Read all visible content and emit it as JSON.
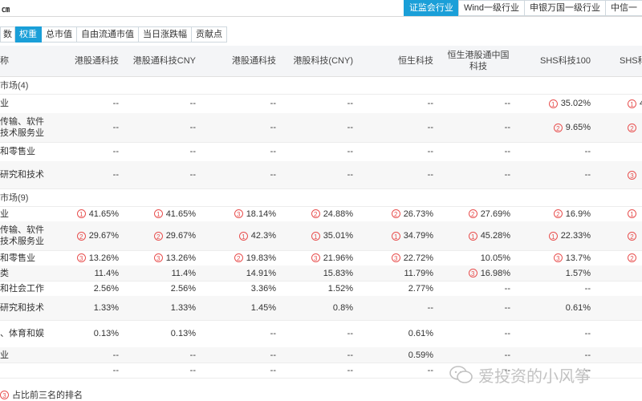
{
  "top_left": "㎝",
  "industry_tabs": [
    "证监会行业",
    "Wind一级行业",
    "申银万国一级行业",
    "中信一"
  ],
  "sub_tabs": [
    "数",
    "权重",
    "总市值",
    "自由流通市值",
    "当日涨跌幅",
    "贡献点"
  ],
  "columns": {
    "name": "称",
    "c1": "港股通科技",
    "c2": "港股通科技CNY",
    "c3": "港股通科技",
    "c4": "港股科技(CNY)",
    "c5": "恒生科技",
    "c6": "恒生港股通中国科技",
    "c7": "SHS科技100",
    "c8": "SHS科"
  },
  "sections": [
    {
      "label": "市场(4)",
      "rows": [
        {
          "name": "业",
          "cells": [
            [
              "",
              "--"
            ],
            [
              "",
              "--"
            ],
            [
              "",
              "--"
            ],
            [
              "",
              "--"
            ],
            [
              "",
              "--"
            ],
            [
              "",
              "--"
            ],
            [
              "1",
              "35.02%"
            ],
            [
              "1",
              "4"
            ]
          ]
        },
        {
          "name": "传输、软件技术服务业",
          "cells": [
            [
              "",
              "--"
            ],
            [
              "",
              "--"
            ],
            [
              "",
              "--"
            ],
            [
              "",
              "--"
            ],
            [
              "",
              "--"
            ],
            [
              "",
              "--"
            ],
            [
              "2",
              "9.65%"
            ],
            [
              "2",
              ""
            ]
          ]
        },
        {
          "name": "和零售业",
          "cells": [
            [
              "",
              "--"
            ],
            [
              "",
              "--"
            ],
            [
              "",
              "--"
            ],
            [
              "",
              "--"
            ],
            [
              "",
              "--"
            ],
            [
              "",
              "--"
            ],
            [
              "",
              "--"
            ],
            [
              "",
              ""
            ]
          ]
        },
        {
          "name": "研究和技术",
          "cells": [
            [
              "",
              "--"
            ],
            [
              "",
              "--"
            ],
            [
              "",
              "--"
            ],
            [
              "",
              "--"
            ],
            [
              "",
              "--"
            ],
            [
              "",
              "--"
            ],
            [
              "",
              "--"
            ],
            [
              "3",
              ""
            ]
          ]
        }
      ]
    },
    {
      "label": "市场(9)",
      "rows": [
        {
          "name": "业",
          "cells": [
            [
              "1",
              "41.65%"
            ],
            [
              "1",
              "41.65%"
            ],
            [
              "3",
              "18.14%"
            ],
            [
              "2",
              "24.88%"
            ],
            [
              "2",
              "26.73%"
            ],
            [
              "2",
              "27.69%"
            ],
            [
              "2",
              "16.9%"
            ],
            [
              "1",
              ""
            ]
          ]
        },
        {
          "name": "传输、软件技术服务业",
          "cells": [
            [
              "2",
              "29.67%"
            ],
            [
              "2",
              "29.67%"
            ],
            [
              "1",
              "42.3%"
            ],
            [
              "1",
              "35.01%"
            ],
            [
              "1",
              "34.79%"
            ],
            [
              "1",
              "45.28%"
            ],
            [
              "1",
              "22.33%"
            ],
            [
              "2",
              ""
            ]
          ]
        },
        {
          "name": "和零售业",
          "cells": [
            [
              "3",
              "13.26%"
            ],
            [
              "3",
              "13.26%"
            ],
            [
              "2",
              "19.83%"
            ],
            [
              "3",
              "21.96%"
            ],
            [
              "3",
              "22.72%"
            ],
            [
              "",
              "10.05%"
            ],
            [
              "3",
              "13.7%"
            ],
            [
              "2",
              ""
            ]
          ]
        },
        {
          "name": "类",
          "cells": [
            [
              "",
              "11.4%"
            ],
            [
              "",
              "11.4%"
            ],
            [
              "",
              "14.91%"
            ],
            [
              "",
              "15.83%"
            ],
            [
              "",
              "11.79%"
            ],
            [
              "3",
              "16.98%"
            ],
            [
              "",
              "1.57%"
            ],
            [
              "",
              ""
            ]
          ]
        },
        {
          "name": "和社会工作",
          "cells": [
            [
              "",
              "2.56%"
            ],
            [
              "",
              "2.56%"
            ],
            [
              "",
              "3.36%"
            ],
            [
              "",
              "1.52%"
            ],
            [
              "",
              "2.77%"
            ],
            [
              "",
              "--"
            ],
            [
              "",
              "--"
            ],
            [
              "",
              ""
            ]
          ]
        },
        {
          "name": "研究和技术",
          "cells": [
            [
              "",
              "1.33%"
            ],
            [
              "",
              "1.33%"
            ],
            [
              "",
              "1.45%"
            ],
            [
              "",
              "0.8%"
            ],
            [
              "",
              "--"
            ],
            [
              "",
              "--"
            ],
            [
              "",
              "0.61%"
            ],
            [
              "",
              ""
            ]
          ]
        },
        {
          "name": "、体育和娱",
          "cells": [
            [
              "",
              "0.13%"
            ],
            [
              "",
              "0.13%"
            ],
            [
              "",
              "--"
            ],
            [
              "",
              "--"
            ],
            [
              "",
              "0.61%"
            ],
            [
              "",
              "--"
            ],
            [
              "",
              "--"
            ],
            [
              "",
              ""
            ]
          ]
        },
        {
          "name": "业",
          "cells": [
            [
              "",
              "--"
            ],
            [
              "",
              "--"
            ],
            [
              "",
              "--"
            ],
            [
              "",
              "--"
            ],
            [
              "",
              "0.59%"
            ],
            [
              "",
              "--"
            ],
            [
              "",
              "--"
            ],
            [
              "",
              ""
            ]
          ]
        },
        {
          "name": "",
          "cells": [
            [
              "",
              "--"
            ],
            [
              "",
              "--"
            ],
            [
              "",
              "--"
            ],
            [
              "",
              "--"
            ],
            [
              "",
              "--"
            ],
            [
              "",
              "--"
            ],
            [
              "",
              "--"
            ],
            [
              "",
              ""
            ]
          ]
        }
      ]
    }
  ],
  "footer_note": "占比前三名的排名",
  "footer_rank": "3",
  "watermark_text": "爱投资的小风筝",
  "colors": {
    "accent": "#1a9fd8",
    "rank": "#e8504f"
  }
}
